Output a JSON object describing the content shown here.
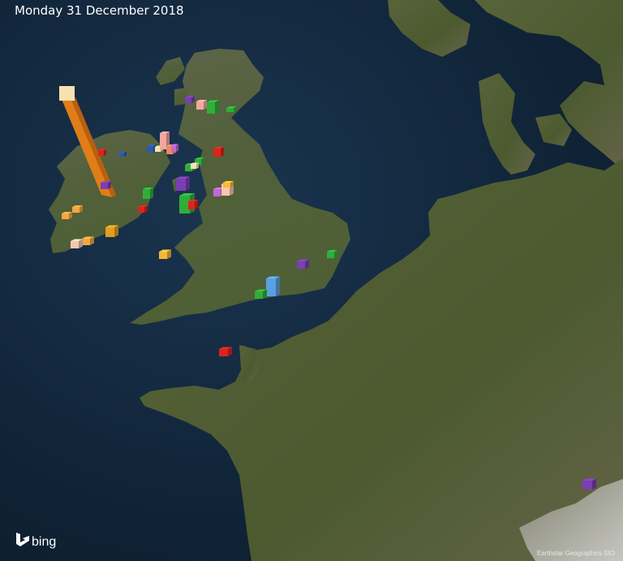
{
  "header": {
    "date": "Monday 31 December 2018"
  },
  "branding": {
    "logo_text": "bing",
    "attribution": "Earthstar Geographics  SIO"
  },
  "colors": {
    "sea": "#142c42",
    "land": "#4f5a34",
    "highland": "#6b6a4c",
    "bar_palette": [
      "#f0c27a",
      "#e07d18",
      "#5aa0e0",
      "#7a3fb0",
      "#2fae3a",
      "#d9251c",
      "#f2a7a0",
      "#f5c53a",
      "#2a5caa",
      "#c468d0"
    ]
  },
  "bars": [
    {
      "color": "#f6e2b0",
      "height": "very-high"
    },
    {
      "color": "#7a3fb0",
      "height": "low"
    },
    {
      "color": "#f2a7a0",
      "height": "low"
    },
    {
      "color": "#2fae3a",
      "height": "low"
    },
    {
      "color": "#2fae3a",
      "height": "low"
    },
    {
      "color": "#2a5caa",
      "height": "low"
    },
    {
      "color": "#f6e2b0",
      "height": "low"
    },
    {
      "color": "#f2a7a0",
      "height": "medium"
    },
    {
      "color": "#ee8a5a",
      "height": "low"
    },
    {
      "color": "#c468d0",
      "height": "low"
    },
    {
      "color": "#d9251c",
      "height": "low"
    },
    {
      "color": "#d9251c",
      "height": "low"
    },
    {
      "color": "#2fae3a",
      "height": "low"
    },
    {
      "color": "#2fae3a",
      "height": "low"
    },
    {
      "color": "#f6e2b0",
      "height": "low"
    },
    {
      "color": "#7a3fb0",
      "height": "low"
    },
    {
      "color": "#7a3fb0",
      "height": "medium"
    },
    {
      "color": "#2fae3a",
      "height": "medium"
    },
    {
      "color": "#d9251c",
      "height": "low"
    },
    {
      "color": "#c468d0",
      "height": "low"
    },
    {
      "color": "#f6c8b0",
      "height": "low"
    },
    {
      "color": "#f5b83a",
      "height": "low"
    },
    {
      "color": "#f5a640",
      "height": "low"
    },
    {
      "color": "#f5a640",
      "height": "low"
    },
    {
      "color": "#f5a640",
      "height": "low"
    },
    {
      "color": "#f6c8b0",
      "height": "low"
    },
    {
      "color": "#e0a020",
      "height": "low"
    },
    {
      "color": "#f5b83a",
      "height": "low"
    },
    {
      "color": "#7a3fb0",
      "height": "low"
    },
    {
      "color": "#2fae3a",
      "height": "low"
    },
    {
      "color": "#5aa0e0",
      "height": "medium"
    },
    {
      "color": "#2fae3a",
      "height": "low"
    },
    {
      "color": "#d9251c",
      "height": "low"
    },
    {
      "color": "#7a3fb0",
      "height": "low"
    },
    {
      "color": "#d9251c",
      "height": "low"
    },
    {
      "color": "#2a5caa",
      "height": "low"
    },
    {
      "color": "#2fae3a",
      "height": "low"
    }
  ]
}
